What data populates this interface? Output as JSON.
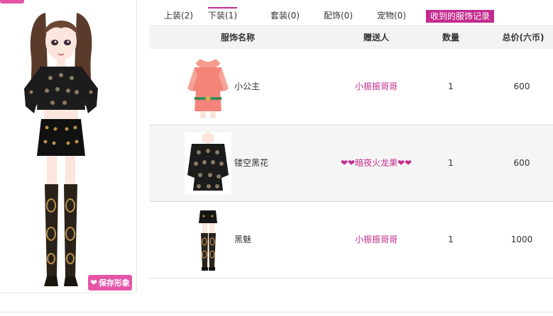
{
  "tabs": [
    {
      "label": "上装(2)"
    },
    {
      "label": "下装(1)"
    },
    {
      "label": "套装(0)"
    },
    {
      "label": "配饰(0)"
    },
    {
      "label": "宠物(0)"
    },
    {
      "label": "收到的服饰记录"
    }
  ],
  "active_tab": "收到的服饰记录",
  "table": {
    "headers": [
      "服饰名称",
      "赠送人",
      "数量",
      "总价(六币)"
    ],
    "rows": [
      {
        "name": "小公主",
        "giver": "小振振哥哥",
        "qty": "1",
        "price": "600",
        "thumb_icon": "pink-blouse-icon"
      },
      {
        "name": "镂空黑花",
        "giver": "❤❤暗夜火龙果❤❤",
        "qty": "1",
        "price": "600",
        "thumb_icon": "black-lace-top-icon"
      },
      {
        "name": "黑魅",
        "giver": "小振振哥哥",
        "qty": "1",
        "price": "1000",
        "thumb_icon": "black-skirt-boots-icon"
      }
    ]
  },
  "avatar": {
    "save_label": "保存形象"
  },
  "colors": {
    "accent": "#c32b8e",
    "button_pink": "#e455a8"
  }
}
